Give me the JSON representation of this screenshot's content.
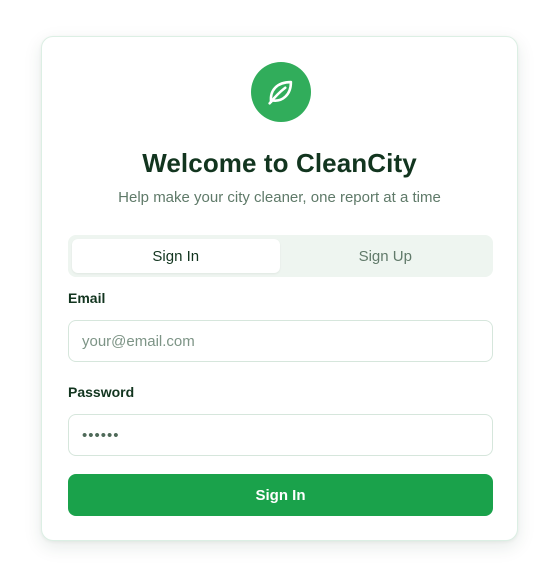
{
  "app": {
    "title": "Welcome to CleanCity",
    "subtitle": "Help make your city cleaner, one report at a time",
    "logo_icon": "leaf-icon",
    "accent_color": "#1aa24b"
  },
  "tabs": [
    {
      "label": "Sign In",
      "active": true
    },
    {
      "label": "Sign Up",
      "active": false
    }
  ],
  "form": {
    "email_label": "Email",
    "email_placeholder": "your@email.com",
    "email_value": "",
    "password_label": "Password",
    "password_value": "••••••",
    "submit_label": "Sign In"
  }
}
